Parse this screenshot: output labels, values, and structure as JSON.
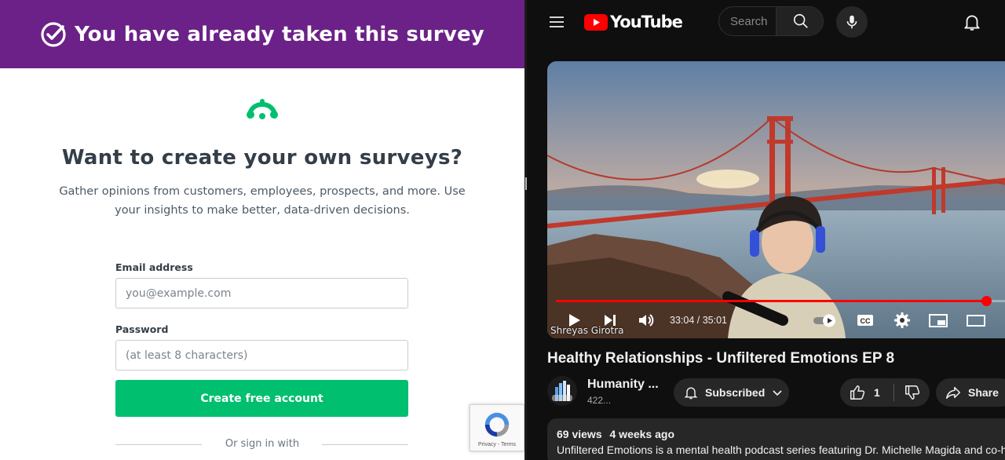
{
  "survey": {
    "banner_title": "You have already taken this survey",
    "cta_title": "Want to create your own surveys?",
    "cta_subtitle": "Gather opinions from customers, employees, prospects, and more. Use your insights to make better, data-driven decisions.",
    "email_label": "Email address",
    "email_placeholder": "you@example.com",
    "password_label": "Password",
    "password_placeholder": "(at least 8 characters)",
    "create_button": "Create free account",
    "signin_text": "Or sign in with",
    "recaptcha_footer": "Privacy - Terms",
    "colors": {
      "banner": "#6b2187",
      "brand_green": "#00bf6f"
    }
  },
  "youtube": {
    "logo_text": "YouTube",
    "search_placeholder": "Search",
    "video": {
      "time_current": "33:04",
      "time_total": "35:01",
      "time_display": "33:04 / 35:01",
      "progress_fraction": 0.944,
      "watermark": "Shreyas Girotra"
    },
    "title": "Healthy Relationships - Unfiltered Emotions EP 8",
    "channel": {
      "name": "Humanity ...",
      "subs": "422..."
    },
    "subscribe_label": "Subscribed",
    "likes": "1",
    "share_label": "Share",
    "description": {
      "views": "69 views",
      "age": "4 weeks ago",
      "text": "Unfiltered Emotions is a mental health podcast series featuring Dr. Michelle Magida and co-host"
    },
    "icons": [
      "menu-icon",
      "search-icon",
      "mic-icon",
      "bell-icon",
      "play-icon",
      "next-icon",
      "volume-icon",
      "autoplay-toggle-icon",
      "captions-icon",
      "settings-icon",
      "miniplayer-icon",
      "theater-icon",
      "bell-outline-icon",
      "chevron-down-icon",
      "thumbs-up-icon",
      "thumbs-down-icon",
      "share-icon"
    ],
    "colors": {
      "accent_red": "#ff0000",
      "background": "#0f0f0f",
      "chip": "#272727"
    }
  }
}
